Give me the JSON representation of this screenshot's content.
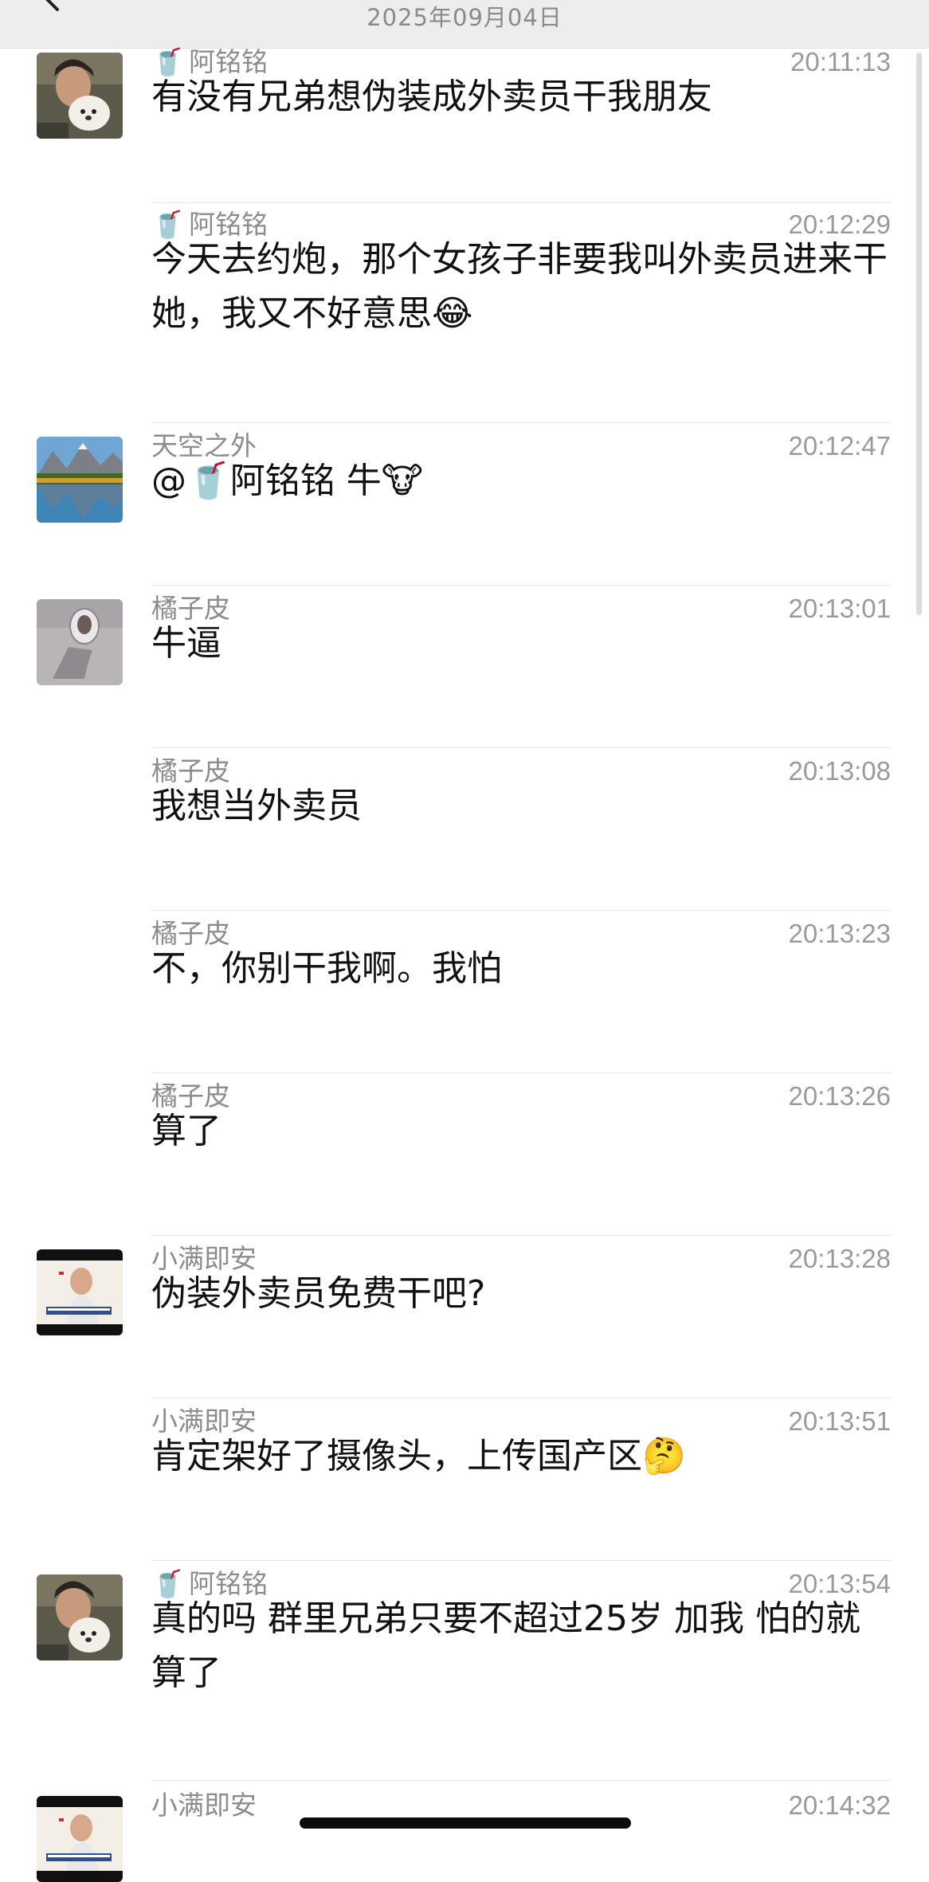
{
  "header": {
    "date": "2025年09月04日"
  },
  "messages": [
    {
      "sender": "阿铭铭",
      "cup": "🥤",
      "time": "20:11:13",
      "text": "有没有兄弟想伪装成外卖员干我朋友",
      "avatar": "avatar-man-dog"
    },
    {
      "sender": "阿铭铭",
      "cup": "🥤",
      "time": "20:12:29",
      "text": "今天去约炮，那个女孩子非要我叫外卖员进来干她，我又不好意思😂",
      "avatar": ""
    },
    {
      "sender": "天空之外",
      "cup": "",
      "time": "20:12:47",
      "text": "@🥤阿铭铭 牛🐮",
      "avatar": "avatar-mountain-lake"
    },
    {
      "sender": "橘子皮",
      "cup": "",
      "time": "20:13:01",
      "text": "牛逼",
      "avatar": "avatar-mirror-selfie"
    },
    {
      "sender": "橘子皮",
      "cup": "",
      "time": "20:13:08",
      "text": "我想当外卖员",
      "avatar": ""
    },
    {
      "sender": "橘子皮",
      "cup": "",
      "time": "20:13:23",
      "text": "不，你别干我啊。我怕",
      "avatar": ""
    },
    {
      "sender": "橘子皮",
      "cup": "",
      "time": "20:13:26",
      "text": "算了",
      "avatar": ""
    },
    {
      "sender": "小满即安",
      "cup": "",
      "time": "20:13:28",
      "text": "伪装外卖员免费干吧?",
      "avatar": "avatar-tv-speaker"
    },
    {
      "sender": "小满即安",
      "cup": "",
      "time": "20:13:51",
      "text": "肯定架好了摄像头，上传国产区🤔",
      "avatar": ""
    },
    {
      "sender": "阿铭铭",
      "cup": "🥤",
      "time": "20:13:54",
      "text": "真的吗 群里兄弟只要不超过25岁 加我  怕的就算了",
      "avatar": "avatar-man-dog"
    },
    {
      "sender": "小满即安",
      "cup": "",
      "time": "20:14:32",
      "text": "",
      "avatar": "avatar-tv-speaker"
    }
  ]
}
